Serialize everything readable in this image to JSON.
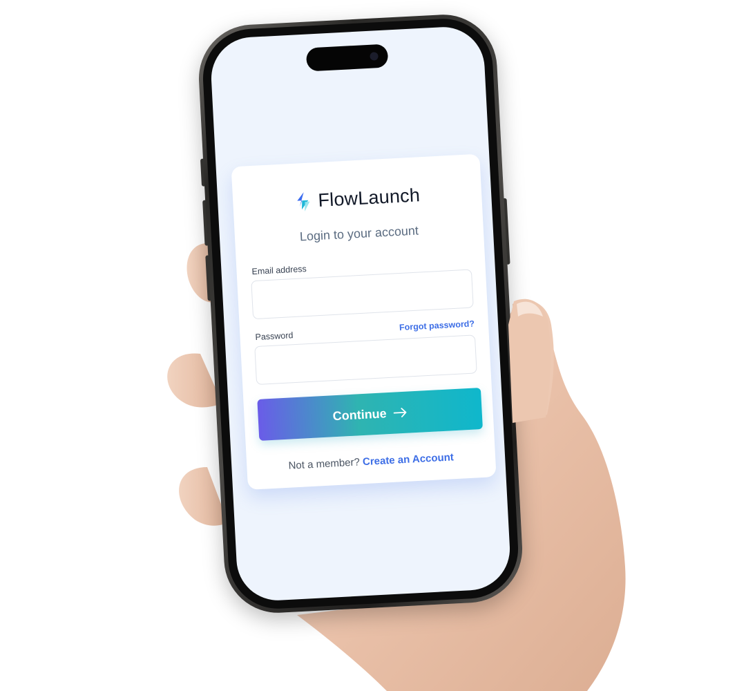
{
  "app": {
    "brand_name": "FlowLaunch",
    "logo_icon": "flowlaunch-logo-icon"
  },
  "login": {
    "subtitle": "Login to your account",
    "email_label": "Email address",
    "email_value": "",
    "email_placeholder": "",
    "password_label": "Password",
    "password_value": "",
    "password_placeholder": "",
    "forgot_link": "Forgot password?",
    "continue_label": "Continue",
    "continue_icon": "arrow-right-icon",
    "footer_text": "Not a member?",
    "create_link": "Create an Account"
  },
  "colors": {
    "screen_background": "#eef4fd",
    "link": "#3d6ee6",
    "button_gradient_start": "#6a5ce8",
    "button_gradient_end": "#0fb7cc",
    "subtitle": "#5a6b80"
  }
}
